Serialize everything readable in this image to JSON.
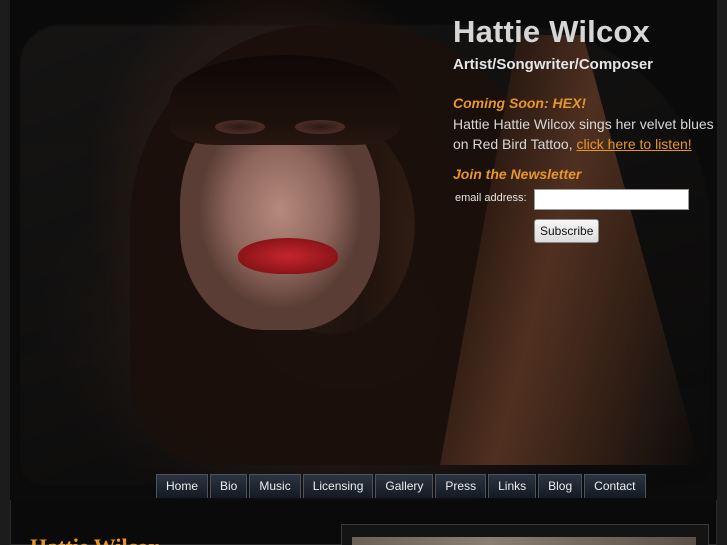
{
  "header": {
    "title": "Hattie Wilcox",
    "subtitle": "Artist/Songwriter/Composer"
  },
  "promo": {
    "heading": "Coming Soon: HEX!",
    "text": "Hattie Hattie Wilcox sings her velvet blues on Red Bird Tattoo,",
    "link": "click here to listen!"
  },
  "newsletter": {
    "heading": "Join the Newsletter",
    "email_label": "email address:",
    "email_value": "",
    "subscribe_label": "Subscribe"
  },
  "nav": {
    "items": [
      "Home",
      "Bio",
      "Music",
      "Licensing",
      "Gallery",
      "Press",
      "Links",
      "Blog",
      "Contact"
    ]
  },
  "footer": {
    "heading": "Hattie Wilcox"
  },
  "colors": {
    "accent": "#e8962a",
    "background": "#0a0a0a"
  }
}
